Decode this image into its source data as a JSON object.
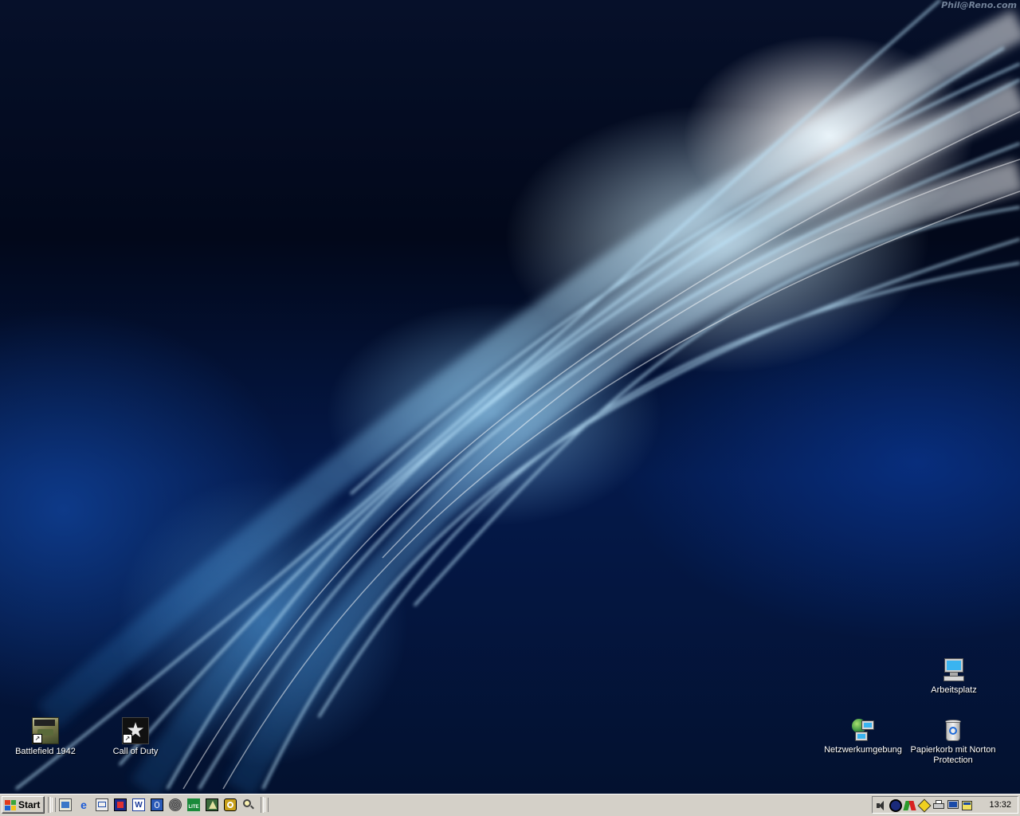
{
  "watermark": "Phil@Reno.com",
  "desktop_icons": {
    "battlefield": {
      "label": "Battlefield 1942",
      "icon": "battlefield-1942-icon"
    },
    "call_of_duty": {
      "label": "Call of Duty",
      "icon": "call-of-duty-icon"
    },
    "arbeitsplatz": {
      "label": "Arbeitsplatz",
      "icon": "my-computer-icon"
    },
    "netzwerk": {
      "label": "Netzwerkumgebung",
      "icon": "network-places-icon"
    },
    "papierkorb": {
      "label": "Papierkorb mit Norton Protection",
      "icon": "recycle-bin-icon"
    }
  },
  "taskbar": {
    "start_label": "Start",
    "quick_launch": [
      "show-desktop-icon",
      "internet-explorer-icon",
      "outlook-express-icon",
      "media-player-icon",
      "word-icon",
      "publisher-icon",
      "cd-player-icon",
      "lite-app-icon",
      "acrobat-icon",
      "update-icon",
      "search-icon"
    ],
    "quick_launch_glyphs": {
      "word": "W",
      "lite": "LITE"
    },
    "tray_icons": [
      "volume-icon",
      "antivirus-icon",
      "network-activity-icon",
      "norton-icon",
      "printer-icon",
      "display-icon",
      "scheduler-icon"
    ],
    "clock": "13:32"
  },
  "colors": {
    "taskbar_bg": "#d4d0c8",
    "desktop_dark": "#02081a",
    "desktop_glow": "#9fd8ff"
  }
}
